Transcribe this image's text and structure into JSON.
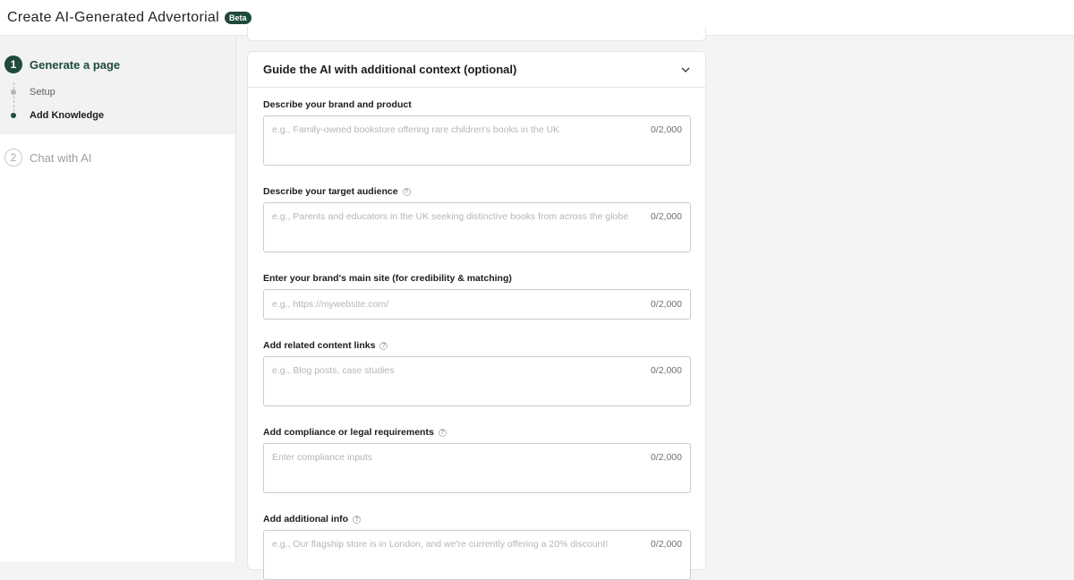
{
  "header": {
    "title": "Create AI-Generated Advertorial",
    "badge": "Beta"
  },
  "sidebar": {
    "steps": [
      {
        "number": "1",
        "label": "Generate a page",
        "substeps": [
          "Setup",
          "Add Knowledge"
        ]
      },
      {
        "number": "2",
        "label": "Chat with AI"
      }
    ]
  },
  "panel": {
    "title": "Guide the AI with additional context (optional)",
    "fields": [
      {
        "label": "Describe your brand and product",
        "placeholder": "e.g., Family-owned bookstore offering rare children's books in the UK",
        "counter": "0/2,000"
      },
      {
        "label": "Describe your target audience",
        "placeholder": "e.g., Parents and educators in the UK seeking distinctive books from across the globe",
        "counter": "0/2,000"
      },
      {
        "label": "Enter your brand's main site (for credibility & matching)",
        "placeholder": "e.g., https://mywebsite.com/",
        "counter": "0/2,000"
      },
      {
        "label": "Add related content links",
        "placeholder": "e.g., Blog posts, case studies",
        "counter": "0/2,000"
      },
      {
        "label": "Add compliance or legal requirements",
        "placeholder": "Enter compliance inputs",
        "counter": "0/2,000"
      },
      {
        "label": "Add additional info",
        "placeholder": "e.g., Our flagship store is in London, and we're currently offering a 20% discount!",
        "counter": "0/2,000"
      }
    ]
  },
  "colors": {
    "brand": "#1e4a3d",
    "border": "#c9ccca",
    "placeholder": "#b3b7b5"
  },
  "icons": {
    "collapse": "chevron-down-icon",
    "info": "info-icon"
  }
}
